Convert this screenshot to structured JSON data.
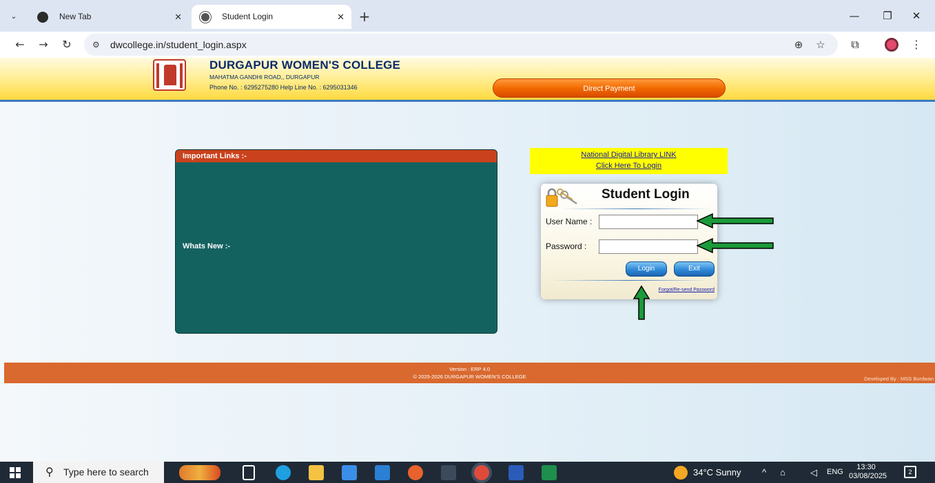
{
  "browser": {
    "tabs": [
      {
        "title": "New Tab",
        "active": false
      },
      {
        "title": "Student Login",
        "active": true
      }
    ],
    "url": "dwcollege.in/student_login.aspx",
    "glyphs": {
      "tab_menu": "⌄",
      "close": "✕",
      "new_tab": "+",
      "minimize": "—",
      "restore": "❐",
      "window_close": "✕",
      "back": "←",
      "forward": "→",
      "reload": "↻",
      "site_info": "⚙",
      "zoom": "⊕",
      "bookmark": "☆",
      "extensions": "⧉",
      "menu": "⋮"
    }
  },
  "header": {
    "college_name": "DURGAPUR WOMEN'S COLLEGE",
    "address": "MAHATMA GANDHI ROAD,, DURGAPUR",
    "phone": "Phone No. : 6295275280   Help Line No. : 6295031346",
    "direct_payment_label": "Direct Payment"
  },
  "links_panel": {
    "title": "Important Links :-",
    "whats_new": "Whats New :-"
  },
  "ndl": {
    "link_text": "National Digital Library LINK",
    "login_text": "Click Here To Login"
  },
  "login": {
    "title": "Student Login",
    "username_label": "User Name :",
    "username_value": "",
    "password_label": "Password :",
    "password_value": "",
    "login_button": "Login",
    "exit_button": "Exit",
    "forgot_link": "Forgot/Re-send Password"
  },
  "footer": {
    "version": "Version : ERP 4.0",
    "copyright": "© 2025-2026   DURGAPUR WOMEN'S COLLEGE",
    "developer": "Developed By : MSS Burdwan"
  },
  "taskbar": {
    "search_placeholder": "Type here to search",
    "weather": "34°C  Sunny",
    "language": "ENG",
    "time": "13:30",
    "date": "03/08/2025",
    "notification_count": "2",
    "glyphs": {
      "search": "⚲",
      "tray_up": "^",
      "wifi": "⌂",
      "volume": "◁"
    }
  },
  "colors": {
    "annotation_arrow": "#1b9a3a",
    "links_panel_bg": "#14625f",
    "links_header_bg": "#c9421d",
    "footer_bg": "#d9692f",
    "ndl_bg": "#ffff00"
  }
}
